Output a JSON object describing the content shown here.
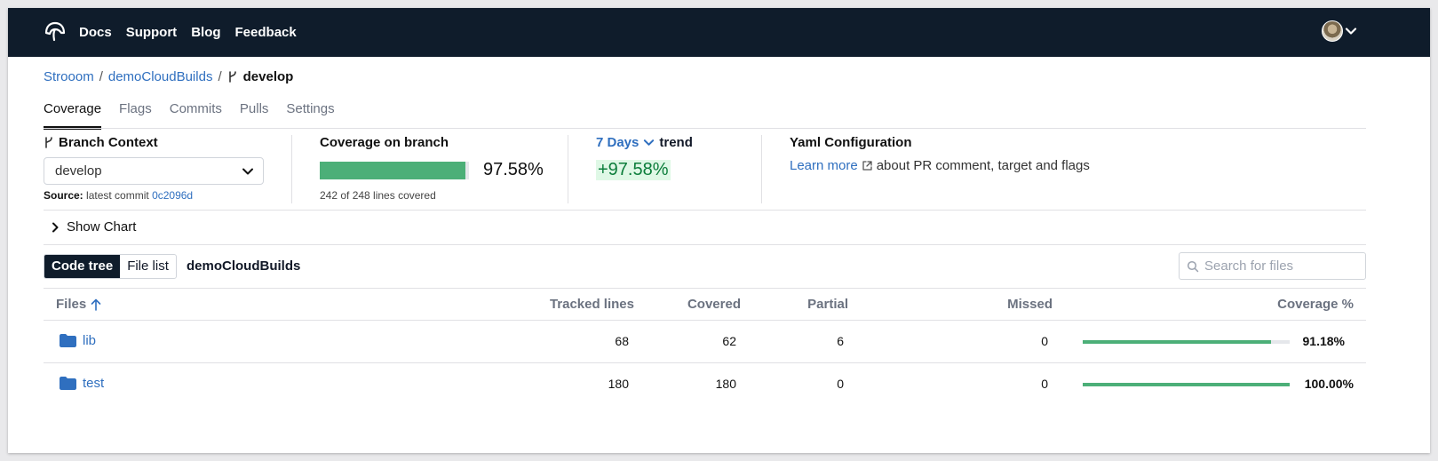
{
  "nav": {
    "links": [
      "Docs",
      "Support",
      "Blog",
      "Feedback"
    ]
  },
  "breadcrumb": {
    "org": "Strooom",
    "repo": "demoCloudBuilds",
    "branch": "develop",
    "separator": "/"
  },
  "tabs": [
    "Coverage",
    "Flags",
    "Commits",
    "Pulls",
    "Settings"
  ],
  "active_tab": "Coverage",
  "branch_context": {
    "title": "Branch Context",
    "selected": "develop",
    "source_label": "Source:",
    "source_text": "latest commit",
    "commit": "0c2096d"
  },
  "coverage_on_branch": {
    "title": "Coverage on branch",
    "percent_text": "97.58%",
    "percent": 97.58,
    "lines_text": "242 of 248 lines covered"
  },
  "trend": {
    "period": "7 Days",
    "label": "trend",
    "value": "+97.58%"
  },
  "yaml": {
    "title": "Yaml Configuration",
    "link": "Learn more",
    "text": "about PR comment, target and flags"
  },
  "show_chart": "Show Chart",
  "view_toggle": {
    "code_tree": "Code tree",
    "file_list": "File list"
  },
  "repo_name": "demoCloudBuilds",
  "search": {
    "placeholder": "Search for files"
  },
  "table": {
    "headers": {
      "files": "Files",
      "tracked": "Tracked lines",
      "covered": "Covered",
      "partial": "Partial",
      "missed": "Missed",
      "coverage": "Coverage %"
    },
    "rows": [
      {
        "name": "lib",
        "tracked": "68",
        "covered": "62",
        "partial": "6",
        "missed": "0",
        "coverage": "91.18%",
        "coverage_value": 91.18
      },
      {
        "name": "test",
        "tracked": "180",
        "covered": "180",
        "partial": "0",
        "missed": "0",
        "coverage": "100.00%",
        "coverage_value": 100.0
      }
    ]
  },
  "colors": {
    "header_bg": "#0f1c2b",
    "link": "#2f6fbf",
    "coverage_green": "#4caf78",
    "trend_bg": "#dff8e6"
  },
  "icons": [
    "codecov-logo-icon",
    "chevron-down-icon",
    "branch-icon",
    "external-link-icon",
    "chevron-right-icon",
    "search-icon",
    "folder-icon",
    "sort-arrow-up-icon"
  ]
}
